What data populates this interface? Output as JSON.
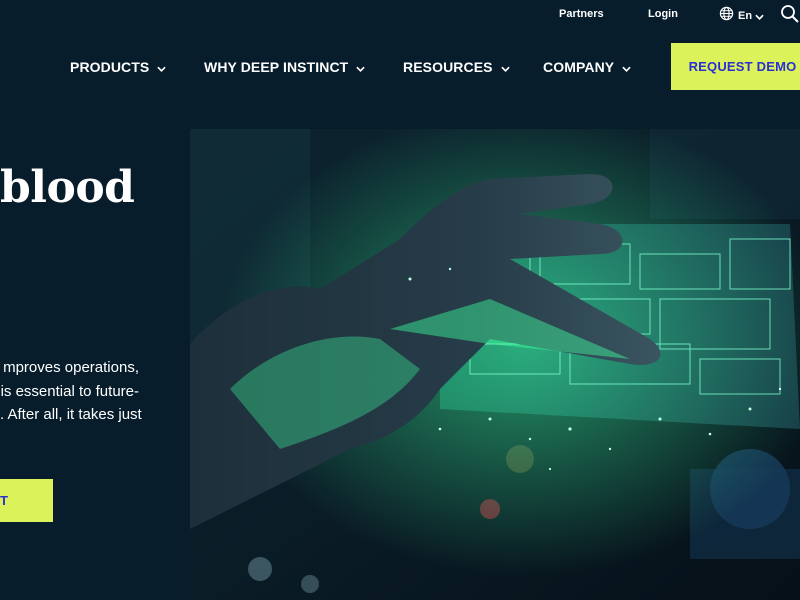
{
  "utility_nav": {
    "partners": "Partners",
    "login": "Login",
    "language": "En"
  },
  "main_nav": {
    "items": [
      {
        "label": "PRODUCTS"
      },
      {
        "label": "WHY DEEP INSTINCT"
      },
      {
        "label": "RESOURCES"
      },
      {
        "label": "COMPANY"
      }
    ],
    "cta": "REQUEST DEMO"
  },
  "hero": {
    "title": "blood",
    "body_lines": [
      "mproves operations,",
      "is essential to future-",
      ". After all, it takes just"
    ],
    "cta": "T"
  },
  "colors": {
    "background": "#071d2b",
    "accent": "#dcf25a",
    "cta_text": "#2a2fd4",
    "glow": "#3dffa0"
  },
  "icons": {
    "globe": "globe-icon",
    "search": "search-icon",
    "chevron": "chevron-down-icon"
  }
}
